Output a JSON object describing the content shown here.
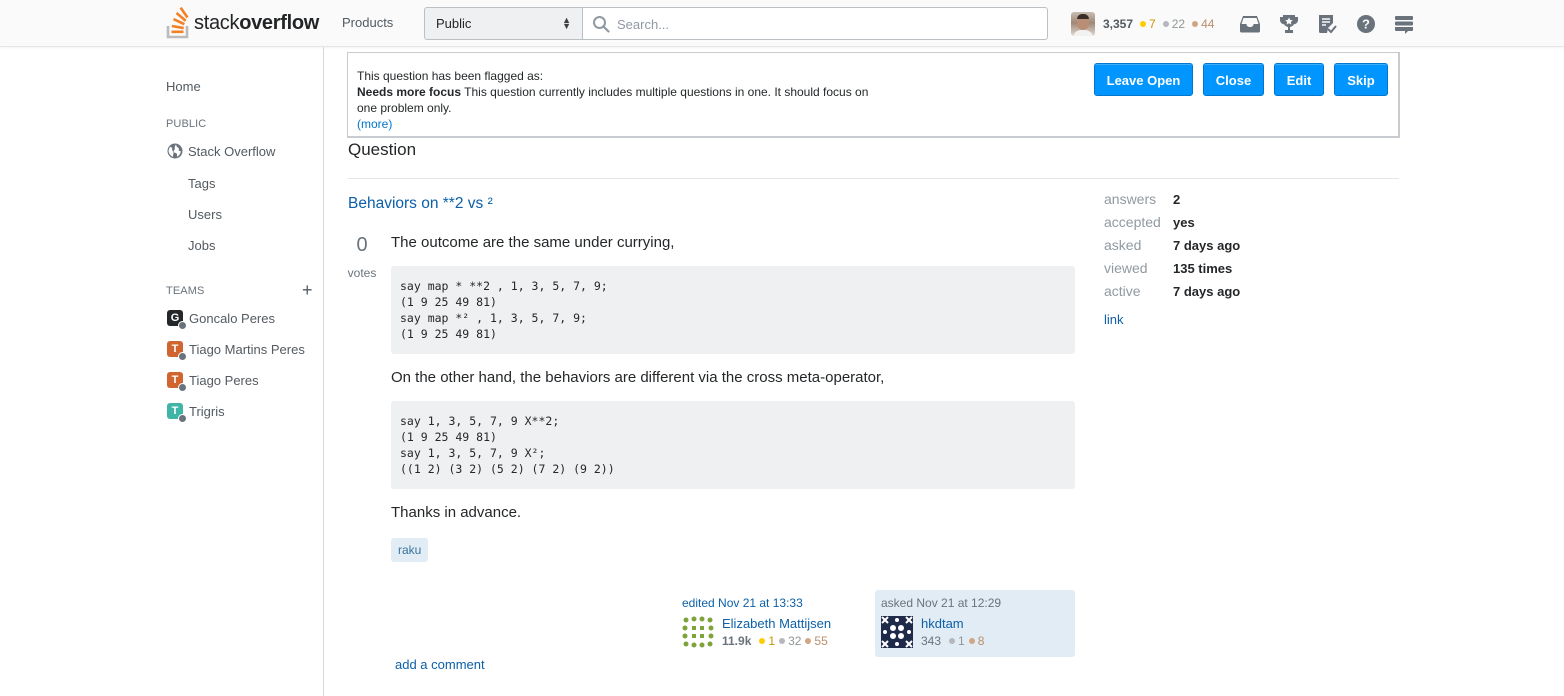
{
  "header": {
    "logo": {
      "light": "stack",
      "bold": "overflow"
    },
    "products_label": "Products",
    "scope_select": {
      "selected": "Public"
    },
    "search": {
      "placeholder": "Search...",
      "value": ""
    },
    "user": {
      "reputation": "3,357",
      "badges": {
        "gold": "7",
        "silver": "22",
        "bronze": "44"
      }
    },
    "icons": [
      "inbox-icon",
      "achievements-icon",
      "review-queues-icon",
      "help-icon",
      "site-switcher-icon"
    ]
  },
  "sidebar": {
    "home": "Home",
    "public_heading": "PUBLIC",
    "public_items": [
      {
        "label": "Stack Overflow",
        "icon": "globe-icon"
      },
      {
        "label": "Tags"
      },
      {
        "label": "Users"
      },
      {
        "label": "Jobs"
      }
    ],
    "teams_heading": "TEAMS",
    "teams_add": "+",
    "teams": [
      {
        "initial": "G",
        "label": "Goncalo Peres",
        "color": "#242729"
      },
      {
        "initial": "T",
        "label": "Tiago Martins Peres",
        "color": "#d1652f"
      },
      {
        "initial": "T",
        "label": "Tiago Peres",
        "color": "#d1652f"
      },
      {
        "initial": "T",
        "label": "Trigris",
        "color": "#3fb5a8"
      }
    ]
  },
  "review": {
    "flag_intro": "This question has been flagged as:",
    "flag_reason": "Needs more focus",
    "flag_text": " This question currently includes multiple questions in one. It should focus on one problem only.",
    "more_link": "(more)",
    "buttons": {
      "leave_open": "Leave Open",
      "close": "Close",
      "edit": "Edit",
      "skip": "Skip"
    },
    "accent": "#0095ff"
  },
  "question": {
    "section_heading": "Question",
    "title": "Behaviors on **2 vs ²",
    "votes": "0",
    "votes_label": "votes",
    "body": {
      "p1": "The outcome are the same under currying,",
      "code1": "say map * **2 , 1, 3, 5, 7, 9;\n(1 9 25 49 81)\nsay map *² , 1, 3, 5, 7, 9;\n(1 9 25 49 81)",
      "p2": "On the other hand, the behaviors are different via the cross meta-operator,",
      "code2": "say 1, 3, 5, 7, 9 X**2;\n(1 9 25 49 81)\nsay 1, 3, 5, 7, 9 X²;\n((1 2) (3 2) (5 2) (7 2) (9 2))",
      "p3": "Thanks in advance."
    },
    "tags": [
      "raku"
    ],
    "editor": {
      "action": "edited Nov 21 at 13:33",
      "name": "Elizabeth Mattijsen",
      "reputation": "11.9k",
      "badges": {
        "gold": "1",
        "silver": "32",
        "bronze": "55"
      }
    },
    "owner": {
      "action": "asked Nov 21 at 12:29",
      "name": "hkdtam",
      "reputation": "343",
      "badges": {
        "silver": "1",
        "bronze": "8"
      }
    },
    "add_comment": "add a comment"
  },
  "stats": {
    "rows": [
      {
        "key": "answers",
        "value": "2"
      },
      {
        "key": "accepted",
        "value": "yes"
      },
      {
        "key": "asked",
        "value": "7 days ago"
      },
      {
        "key": "viewed",
        "value": "135 times"
      },
      {
        "key": "active",
        "value": "7 days ago"
      }
    ],
    "link": "link"
  }
}
